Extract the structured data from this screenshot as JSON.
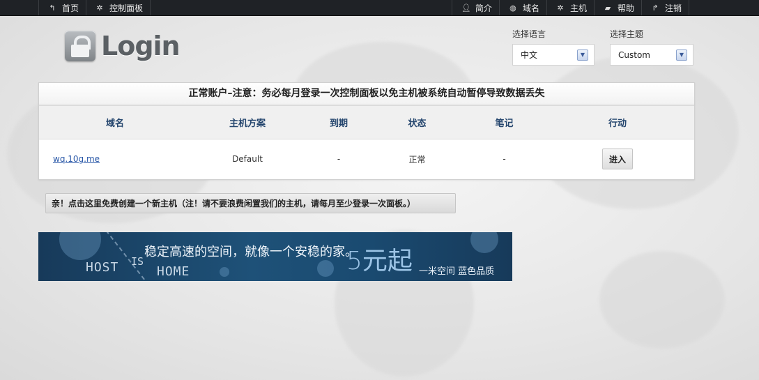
{
  "nav_left": [
    {
      "label": "首页",
      "icon": "home-back-icon"
    },
    {
      "label": "控制面板",
      "icon": "gear-icon"
    }
  ],
  "nav_right": [
    {
      "label": "简介",
      "icon": "user-icon"
    },
    {
      "label": "域名",
      "icon": "globe-icon"
    },
    {
      "label": "主机",
      "icon": "gear-icon"
    },
    {
      "label": "帮助",
      "icon": "chat-icon"
    },
    {
      "label": "注销",
      "icon": "logout-arrow-icon"
    }
  ],
  "logo": {
    "text": "Login"
  },
  "language": {
    "label": "选择语言",
    "value": "中文"
  },
  "theme": {
    "label": "选择主题",
    "value": "Custom"
  },
  "panel": {
    "notice": "正常账户–注意：务必每月登录一次控制面板以免主机被系统自动暂停导致数据丢失",
    "headers": [
      "域名",
      "主机方案",
      "到期",
      "状态",
      "笔记",
      "行动"
    ],
    "rows": [
      {
        "domain": "wq.10g.me",
        "plan": "Default",
        "expiry": "-",
        "status": "正常",
        "note": "-",
        "action": "进入"
      }
    ]
  },
  "create_button": "亲！点击这里免费创建一个新主机（注！请不要浪费闲置我们的主机，请每月至少登录一次面板。）",
  "banner": {
    "slogan": "稳定高速的空间，就像一个安稳的家。",
    "price": "5元起",
    "brand": "一米空间  蓝色品质",
    "host": "HOST",
    "is": "IS",
    "home": "HOME"
  }
}
